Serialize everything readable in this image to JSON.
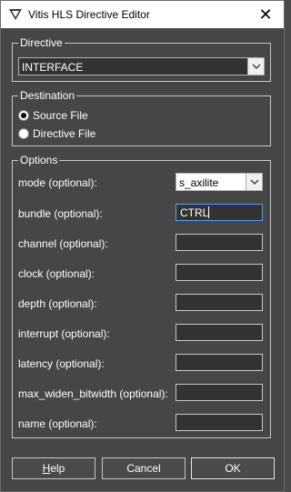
{
  "window": {
    "title": "Vitis HLS Directive Editor"
  },
  "directive": {
    "group_label": "Directive",
    "selected": "INTERFACE"
  },
  "destination": {
    "group_label": "Destination",
    "options": [
      {
        "label": "Source File",
        "checked": true
      },
      {
        "label": "Directive File",
        "checked": false
      }
    ]
  },
  "options": {
    "group_label": "Options",
    "mode": {
      "label": "mode (optional):",
      "value": "s_axilite"
    },
    "bundle": {
      "label": "bundle (optional):",
      "value": "CTRL"
    },
    "fields": [
      {
        "label": "channel (optional):",
        "value": ""
      },
      {
        "label": "clock (optional):",
        "value": ""
      },
      {
        "label": "depth (optional):",
        "value": ""
      },
      {
        "label": "interrupt (optional):",
        "value": ""
      },
      {
        "label": "latency (optional):",
        "value": ""
      },
      {
        "label": "max_widen_bitwidth (optional):",
        "value": ""
      },
      {
        "label": "name (optional):",
        "value": ""
      }
    ]
  },
  "buttons": {
    "help_first": "H",
    "help_rest": "elp",
    "cancel": "Cancel",
    "ok": "OK"
  },
  "icons": {
    "close": "close-icon",
    "app": "vitis-app-icon",
    "dropdown": "chevron-down-icon"
  }
}
